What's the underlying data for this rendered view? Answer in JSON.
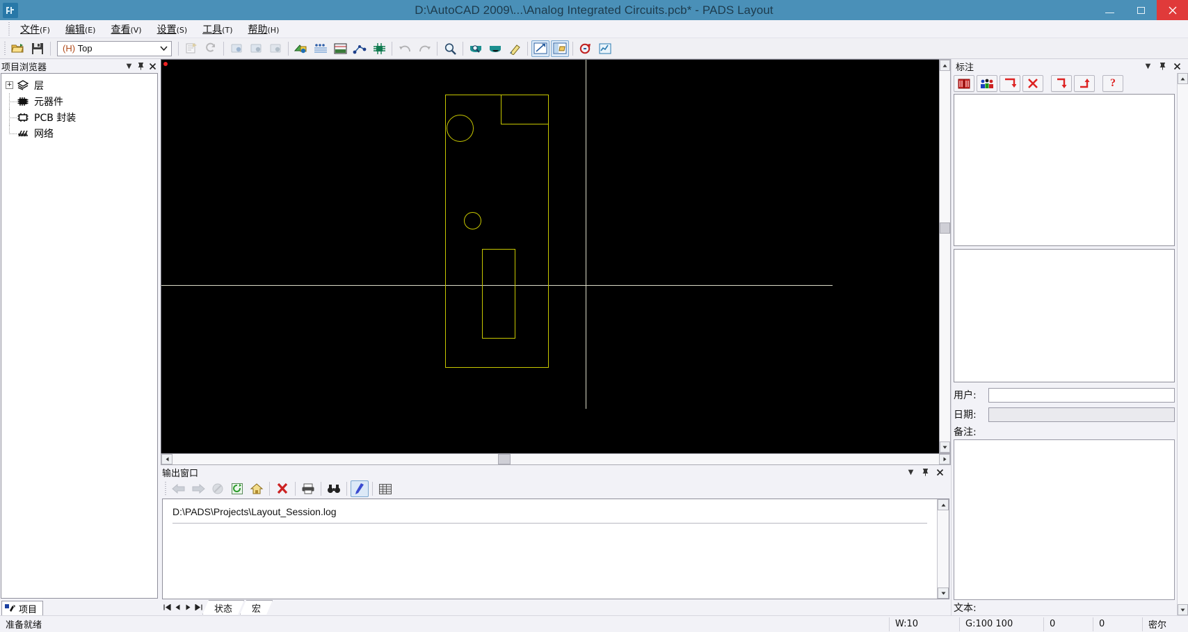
{
  "window": {
    "title": "D:\\AutoCAD 2009\\...\\Analog Integrated Circuits.pcb* - PADS Layout",
    "app_icon": "pads-layout-icon",
    "minimize_label": "–",
    "maximize_label": "❐",
    "close_label": "✕",
    "accent_color": "#4a90b8",
    "close_color": "#e03a3a"
  },
  "menubar": {
    "items": [
      {
        "name": "file",
        "label": "文件",
        "mnemonic": "F"
      },
      {
        "name": "edit",
        "label": "编辑",
        "mnemonic": "E"
      },
      {
        "name": "view",
        "label": "查看",
        "mnemonic": "V"
      },
      {
        "name": "setup",
        "label": "设置",
        "mnemonic": "S"
      },
      {
        "name": "tools",
        "label": "工具",
        "mnemonic": "T"
      },
      {
        "name": "help",
        "label": "帮助",
        "mnemonic": "H"
      }
    ]
  },
  "toolbar": {
    "open_icon": "open-folder-icon",
    "save_icon": "save-disk-icon",
    "layer_select": {
      "prefix": "(H)",
      "value": "Top",
      "arrow": "⌵"
    },
    "buttons": [
      {
        "name": "properties-icon",
        "enabled": false
      },
      {
        "name": "refresh-icon",
        "enabled": false
      },
      {
        "name": "photo-add-icon",
        "enabled": false
      },
      {
        "name": "photo-remove-icon",
        "enabled": false
      },
      {
        "name": "pour-manager-icon",
        "enabled": true
      },
      {
        "name": "plane-layers-icon",
        "enabled": true
      },
      {
        "name": "dimension-icon",
        "enabled": true
      },
      {
        "name": "route-icon",
        "enabled": true
      },
      {
        "name": "drc-icon",
        "enabled": true
      },
      {
        "name": "undo-icon",
        "enabled": false
      },
      {
        "name": "redo-icon",
        "enabled": false
      },
      {
        "name": "zoom-icon",
        "enabled": true
      },
      {
        "name": "zoom-in-icon",
        "enabled": true
      },
      {
        "name": "zoom-out-icon",
        "enabled": true
      },
      {
        "name": "redraw-icon",
        "enabled": true
      },
      {
        "name": "design-tools-icon",
        "enabled": true,
        "active": true
      },
      {
        "name": "project-explorer-icon",
        "enabled": true,
        "active": true
      },
      {
        "name": "ecostat-icon",
        "enabled": true
      },
      {
        "name": "report-icon",
        "enabled": true
      }
    ]
  },
  "project_browser": {
    "title": "项目浏览器",
    "collapse_icon": "▼",
    "pin_icon": "⍡",
    "close_icon": "✕",
    "tree": [
      {
        "name": "layers",
        "label": "层",
        "icon": "layers-icon",
        "expander": "+"
      },
      {
        "name": "parts",
        "label": "元器件",
        "icon": "chip-icon",
        "expander": ""
      },
      {
        "name": "pcb-decals",
        "label": "PCB 封装",
        "icon": "decal-icon",
        "expander": ""
      },
      {
        "name": "nets",
        "label": "网络",
        "icon": "nets-icon",
        "expander": ""
      }
    ],
    "tab_label": "项目"
  },
  "canvas": {
    "background_color": "#000000",
    "trace_color": "#c8c800",
    "crosshair_color": "#dcdcc8",
    "origin_marker_color": "#ee2222",
    "h_scroll_left": "‹",
    "h_scroll_right": "›",
    "v_scroll_up": "∧",
    "v_scroll_down": "∨"
  },
  "output_window": {
    "title": "输出窗口",
    "collapse_icon": "▼",
    "pin_icon": "⍡",
    "close_icon": "✕",
    "toolbar": [
      {
        "name": "back-arrow-icon",
        "enabled": false
      },
      {
        "name": "forward-arrow-icon",
        "enabled": false
      },
      {
        "name": "stop-icon",
        "enabled": false
      },
      {
        "name": "refresh-icon",
        "enabled": true
      },
      {
        "name": "home-icon",
        "enabled": true
      },
      {
        "name": "clear-x-icon",
        "enabled": true
      },
      {
        "name": "print-icon",
        "enabled": true
      },
      {
        "name": "find-binoculars-icon",
        "enabled": true
      },
      {
        "name": "highlight-pen-icon",
        "enabled": true,
        "active": true
      },
      {
        "name": "grid-view-icon",
        "enabled": true
      }
    ],
    "log_path": "D:\\PADS\\Projects\\Layout_Session.log",
    "nav": {
      "first": "⏮",
      "prev": "◀",
      "next": "▶",
      "last": "⏭"
    },
    "tabs": [
      {
        "name": "status",
        "label": "状态",
        "active": true
      },
      {
        "name": "macro",
        "label": "宏",
        "active": false
      }
    ]
  },
  "annotation_panel": {
    "title": "标注",
    "collapse_icon": "▼",
    "pin_icon": "⍡",
    "close_icon": "✕",
    "toolbar": [
      {
        "name": "book-icon",
        "label": "📕"
      },
      {
        "name": "team-icon",
        "label": "👥"
      },
      {
        "name": "arrow-back-left-icon",
        "label": "↰"
      },
      {
        "name": "delete-x-icon",
        "label": "✗"
      },
      {
        "name": "arrow-down-right-icon",
        "label": "↳"
      },
      {
        "name": "arrow-right-up-icon",
        "label": "↱"
      },
      {
        "name": "help-question-icon",
        "label": "?"
      }
    ],
    "fields": [
      {
        "name": "user",
        "label": "用户:",
        "value": "",
        "readonly": false
      },
      {
        "name": "date",
        "label": "日期:",
        "value": "",
        "readonly": true
      }
    ],
    "notes_label": "备注:",
    "notes_value": "",
    "text_label": "文本:"
  },
  "statusbar": {
    "message": "准备就绪",
    "cells": [
      {
        "name": "width",
        "value": "W:10"
      },
      {
        "name": "grid",
        "value": "G:100 100"
      },
      {
        "name": "coord-x",
        "value": "0"
      },
      {
        "name": "coord-y",
        "value": "0"
      },
      {
        "name": "units",
        "value": "密尔"
      }
    ]
  }
}
